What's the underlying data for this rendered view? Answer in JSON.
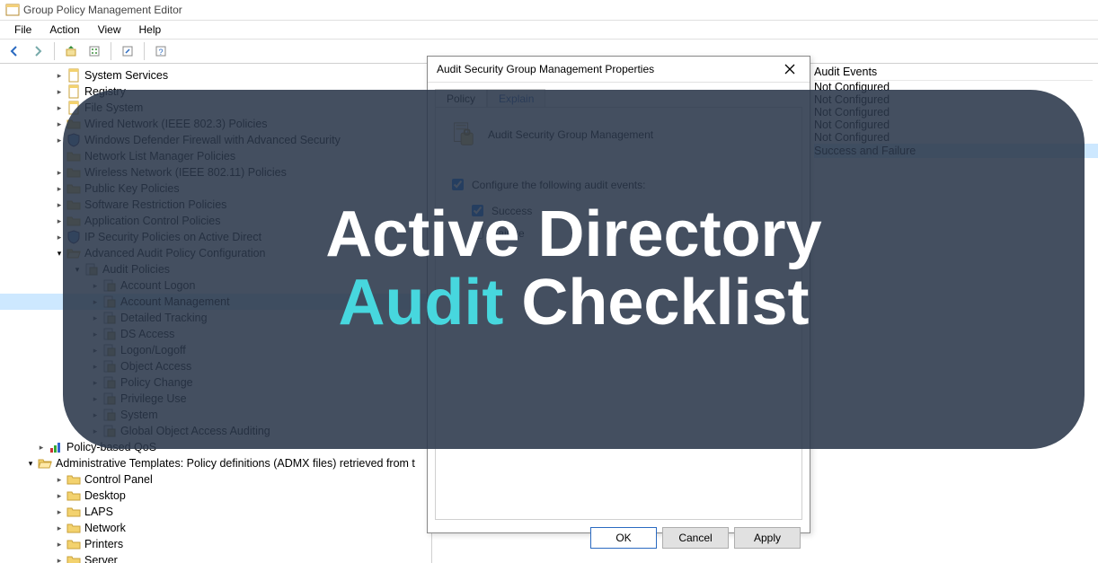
{
  "window": {
    "title": "Group Policy Management Editor"
  },
  "menu": [
    "File",
    "Action",
    "View",
    "Help"
  ],
  "toolbar_icons": [
    "back",
    "forward",
    "up",
    "options",
    "refresh",
    "export",
    "help"
  ],
  "tree": {
    "top_items": [
      {
        "label": "System Services",
        "icon": "scroll",
        "expandable": true
      },
      {
        "label": "Registry",
        "icon": "scroll",
        "expandable": true
      },
      {
        "label": "File System",
        "icon": "scroll",
        "expandable": true
      },
      {
        "label": "Wired Network (IEEE 802.3) Policies",
        "icon": "folder",
        "expandable": true
      },
      {
        "label": "Windows Defender Firewall with Advanced Security",
        "icon": "shield",
        "expandable": true
      },
      {
        "label": "Network List Manager Policies",
        "icon": "folder",
        "expandable": false
      },
      {
        "label": "Wireless Network (IEEE 802.11) Policies",
        "icon": "folder",
        "expandable": true
      },
      {
        "label": "Public Key Policies",
        "icon": "folder",
        "expandable": true
      },
      {
        "label": "Software Restriction Policies",
        "icon": "folder",
        "expandable": true
      },
      {
        "label": "Application Control Policies",
        "icon": "folder",
        "expandable": true
      },
      {
        "label": "IP Security Policies on Active Direct",
        "icon": "shield",
        "expandable": true
      }
    ],
    "adv_label": "Advanced Audit Policy Configuration",
    "audit_label": "Audit Policies",
    "audit_items": [
      "Account Logon",
      "Account Management",
      "Detailed Tracking",
      "DS Access",
      "Logon/Logoff",
      "Object Access",
      "Policy Change",
      "Privilege Use",
      "System",
      "Global Object Access Auditing"
    ],
    "qos_label": "Policy-based QoS",
    "admx_label": "Administrative Templates: Policy definitions (ADMX files) retrieved from t",
    "admx_items": [
      "Control Panel",
      "Desktop",
      "LAPS",
      "Network",
      "Printers",
      "Server"
    ]
  },
  "right": {
    "header": "Audit Events",
    "values": [
      "Not Configured",
      "Not Configured",
      "Not Configured",
      "Not Configured",
      "Not Configured",
      "Success and Failure"
    ]
  },
  "dialog": {
    "title": "Audit Security Group Management Properties",
    "tabs": [
      "Policy",
      "Explain"
    ],
    "heading": "Audit Security Group Management",
    "configure_label": "Configure the following audit events:",
    "success_label": "Success",
    "failure_label": "Failure",
    "buttons": {
      "ok": "OK",
      "cancel": "Cancel",
      "apply": "Apply"
    }
  },
  "overlay": {
    "line1a": "Active Directory",
    "line2a": "Audit",
    "line2b": " Checklist"
  }
}
